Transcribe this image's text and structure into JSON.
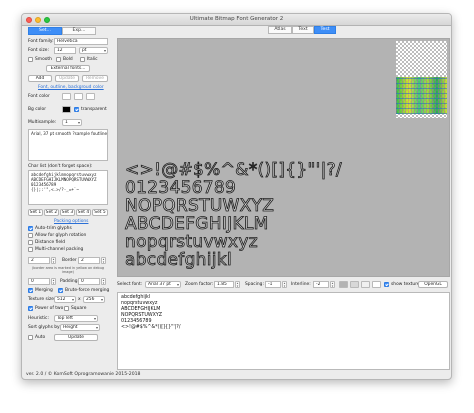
{
  "window": {
    "title": "Ultimate Bitmap Font Generator 2"
  },
  "left_tabs": [
    "Set...",
    "Exp..."
  ],
  "view_tabs": [
    "Atlas",
    "Text",
    "Test"
  ],
  "font": {
    "family_label": "Font family:",
    "family_value": "Helvetica",
    "size_label": "Font size:",
    "size_value": "12",
    "size_unit": "pt",
    "smooth_label": "Smooth",
    "bold_label": "Bold",
    "italic_label": "Italic",
    "external_fonts_label": "External fonts...",
    "add_label": "Add",
    "update_label": "Update",
    "remove_label": "Remove"
  },
  "colors": {
    "section_label": "Font, outline, backgroud color",
    "font_color_label": "Font color",
    "bg_color_label": "Bg color",
    "transparent_label": "transparent",
    "swatch_black": "#000000",
    "swatch_white": "#ffffff",
    "accent": "#3e8ef7"
  },
  "multisample": {
    "label": "Multisample:",
    "value": "1"
  },
  "font_list_text": "Arial, 37 pt smooth ?sample foutline",
  "charlist": {
    "label": "Char list (don't forget space):",
    "lines": [
      "abcdefghijklmnopqrstuvwxyz",
      "ABCDEFGHIJKLMNOPQRSTUVWXYZ",
      "0123456789",
      "{}|;:'\",<.>/?-_=+`~"
    ]
  },
  "sets": [
    "Set 1",
    "Set 2",
    "Set 3",
    "Set 4",
    "Set 5"
  ],
  "packing": {
    "section_label": "Packing options",
    "auto_trim_label": "Auto-trim glyphs",
    "allow_rotation_label": "Allow for glyph rotation",
    "distance_field_label": "Distance field",
    "multichannel_label": "Multi-channel packing",
    "spacing_left": "2",
    "border_label": "Border",
    "border_value": "2",
    "spacing_note": "(border area is marked in yellow on debug image)",
    "padding_left": "0",
    "padding_label": "Padding",
    "padding_value": "0",
    "merging_label": "Merging",
    "brute_force_label": "Brute-force merging",
    "texture_size_label": "Texture size",
    "texture_w": "512",
    "texture_x": "x",
    "texture_h": "256",
    "power_of_two_label": "Power of two",
    "square_label": "Square",
    "heuristic_label": "Heuristic:",
    "heuristic_value": "Top left",
    "sort_label": "Sort glyphs by:",
    "sort_value": "Height",
    "auto_label": "Auto",
    "update_label": "Update"
  },
  "preview": {
    "lines": [
      "<>!@#$%^&*()[]{}\"'|?/",
      "0123456789",
      "NOPQRSTUWXYZ",
      "ABCDEFGHIJKLM",
      "nopqrstuvwxyz",
      "abcdefghijkl"
    ]
  },
  "bottom_bar": {
    "select_font_label": "Select font:",
    "select_font_value": "Arial 37 pt",
    "zoom_label": "Zoom factor:",
    "zoom_value": "1.85",
    "spacing_label": "Spacing:",
    "spacing_value": "-1",
    "interline_label": "Interline:",
    "interline_value": "-2",
    "show_texture_label": "show texture",
    "opengl_label": "OpenGL",
    "swatches": [
      "#b3b3b3",
      "#d8d8d8",
      "#f0f0f0",
      "#ffffff"
    ]
  },
  "sample_text": [
    "abcdefghijkl",
    "nopqrstuvwxyz",
    "ABCDEFGHIJKLM",
    "NOPQRSTUWXYZ",
    "0123456789",
    "<>!@#$%^&*()[]{}\"'|?/"
  ],
  "footer": "ver. 2.0 / © KomSoft Oprogramowanie 2015-2018"
}
